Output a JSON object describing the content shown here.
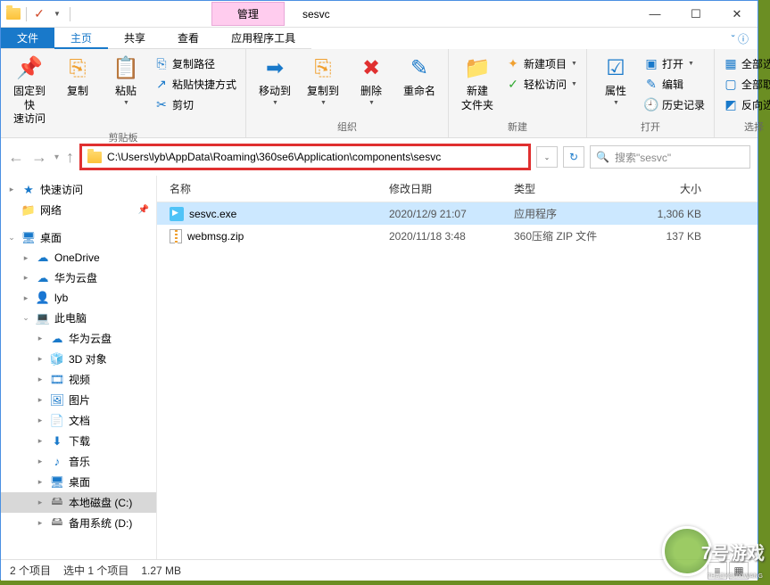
{
  "title": {
    "manage": "管理",
    "text": "sesvc"
  },
  "tabs": {
    "file": "文件",
    "home": "主页",
    "share": "共享",
    "view": "查看",
    "apptools": "应用程序工具"
  },
  "ribbon": {
    "pin": "固定到快\n速访问",
    "copy": "复制",
    "paste": "粘贴",
    "copypath": "复制路径",
    "pastelink": "粘贴快捷方式",
    "cut": "剪切",
    "clipboard": "剪贴板",
    "moveto": "移动到",
    "copyto": "复制到",
    "delete": "删除",
    "rename": "重命名",
    "organize": "组织",
    "newfolder": "新建\n文件夹",
    "newitem": "新建项目",
    "easyaccess": "轻松访问",
    "new": "新建",
    "properties": "属性",
    "openlabel": "打开",
    "edit": "编辑",
    "history": "历史记录",
    "open": "打开",
    "selectall": "全部选择",
    "selectnone": "全部取消",
    "invert": "反向选择",
    "select": "选择"
  },
  "address": {
    "path": "C:\\Users\\lyb\\AppData\\Roaming\\360se6\\Application\\components\\sesvc"
  },
  "search": {
    "placeholder": "搜索\"sesvc\""
  },
  "nav": {
    "quickaccess": "快速访问",
    "network": "网络",
    "desktop": "桌面",
    "onedrive": "OneDrive",
    "huawei": "华为云盘",
    "user": "lyb",
    "thispc": "此电脑",
    "huawei2": "华为云盘",
    "obj3d": "3D 对象",
    "videos": "视频",
    "pictures": "图片",
    "documents": "文档",
    "downloads": "下载",
    "music": "音乐",
    "desktop2": "桌面",
    "localc": "本地磁盘 (C:)",
    "backup": "备用系统 (D:)"
  },
  "columns": {
    "name": "名称",
    "date": "修改日期",
    "type": "类型",
    "size": "大小"
  },
  "files": [
    {
      "name": "sesvc.exe",
      "date": "2020/12/9 21:07",
      "type": "应用程序",
      "size": "1,306 KB",
      "icon": "exe",
      "selected": true
    },
    {
      "name": "webmsg.zip",
      "date": "2020/11/18 3:48",
      "type": "360压缩 ZIP 文件",
      "size": "137 KB",
      "icon": "zip",
      "selected": false
    }
  ],
  "status": {
    "items": "2 个项目",
    "selected": "选中 1 个项目",
    "size": "1.27 MB"
  },
  "watermark": {
    "text": "7号游戏",
    "sub": "7HAOYOUXIWANG"
  }
}
